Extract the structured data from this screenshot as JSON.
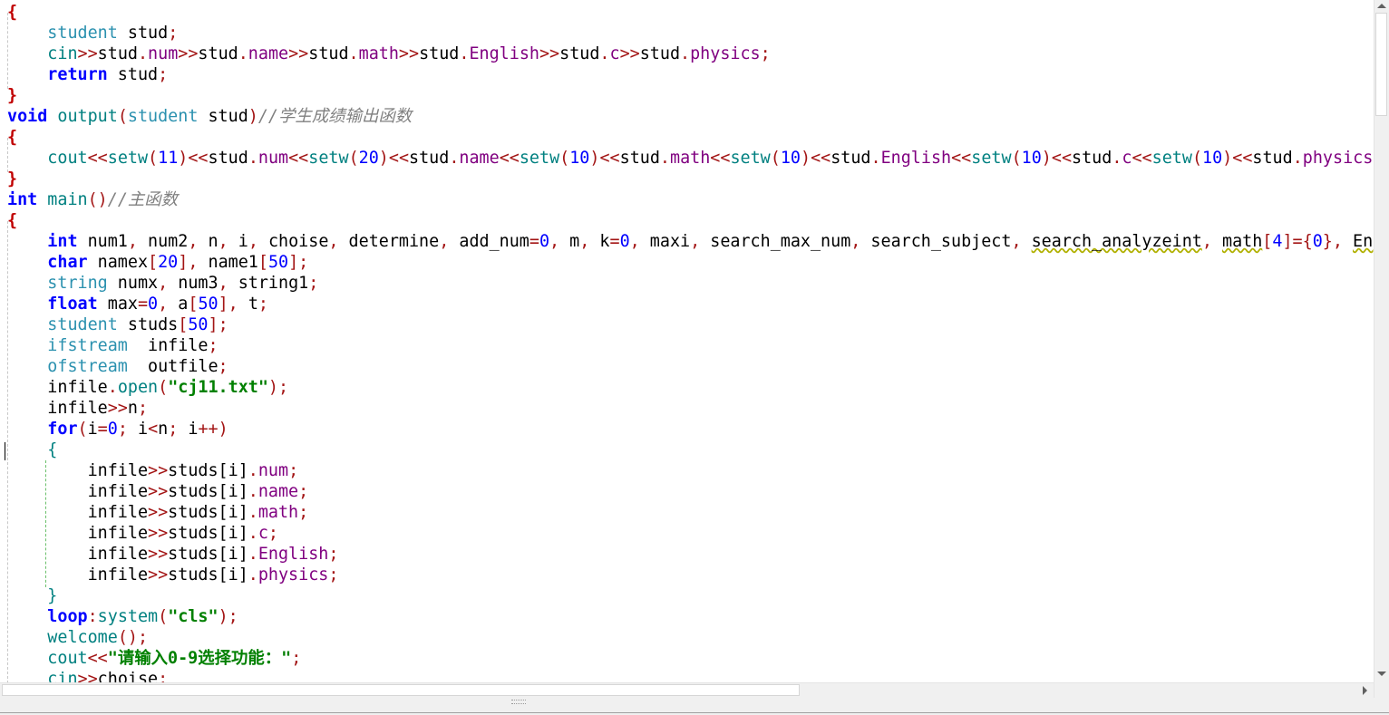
{
  "editor": {
    "lines": [
      [
        [
          "{",
          "br"
        ]
      ],
      [
        [
          "    ",
          ""
        ],
        [
          "student",
          "tp"
        ],
        [
          " stud",
          ""
        ],
        [
          ";",
          "sm"
        ]
      ],
      [
        [
          "    ",
          ""
        ],
        [
          "cin",
          "fn"
        ],
        [
          ">>",
          "op"
        ],
        [
          "stud",
          ""
        ],
        [
          ".",
          "op"
        ],
        [
          "num",
          "mb"
        ],
        [
          ">>",
          "op"
        ],
        [
          "stud",
          ""
        ],
        [
          ".",
          "op"
        ],
        [
          "name",
          "mb"
        ],
        [
          ">>",
          "op"
        ],
        [
          "stud",
          ""
        ],
        [
          ".",
          "op"
        ],
        [
          "math",
          "mb"
        ],
        [
          ">>",
          "op"
        ],
        [
          "stud",
          ""
        ],
        [
          ".",
          "op"
        ],
        [
          "English",
          "mb"
        ],
        [
          ">>",
          "op"
        ],
        [
          "stud",
          ""
        ],
        [
          ".",
          "op"
        ],
        [
          "c",
          "mb"
        ],
        [
          ">>",
          "op"
        ],
        [
          "stud",
          ""
        ],
        [
          ".",
          "op"
        ],
        [
          "physics",
          "mb"
        ],
        [
          ";",
          "sm"
        ]
      ],
      [
        [
          "    ",
          ""
        ],
        [
          "return",
          "kw"
        ],
        [
          " stud",
          ""
        ],
        [
          ";",
          "sm"
        ]
      ],
      [
        [
          "}",
          "br"
        ]
      ],
      [
        [
          "void",
          "kw"
        ],
        [
          " ",
          ""
        ],
        [
          "output",
          "fn"
        ],
        [
          "(",
          "op"
        ],
        [
          "student",
          "tp"
        ],
        [
          " stud",
          ""
        ],
        [
          ")",
          "op"
        ],
        [
          "//学生成绩输出函数",
          "cm"
        ]
      ],
      [
        [
          "{",
          "br"
        ]
      ],
      [
        [
          "    ",
          ""
        ],
        [
          "cout",
          "fn"
        ],
        [
          "<<",
          "op"
        ],
        [
          "setw",
          "fn"
        ],
        [
          "(",
          "op"
        ],
        [
          "11",
          "nm"
        ],
        [
          ")",
          "op"
        ],
        [
          "<<",
          "op"
        ],
        [
          "stud",
          ""
        ],
        [
          ".",
          "op"
        ],
        [
          "num",
          "mb"
        ],
        [
          "<<",
          "op"
        ],
        [
          "setw",
          "fn"
        ],
        [
          "(",
          "op"
        ],
        [
          "20",
          "nm"
        ],
        [
          ")",
          "op"
        ],
        [
          "<<",
          "op"
        ],
        [
          "stud",
          ""
        ],
        [
          ".",
          "op"
        ],
        [
          "name",
          "mb"
        ],
        [
          "<<",
          "op"
        ],
        [
          "setw",
          "fn"
        ],
        [
          "(",
          "op"
        ],
        [
          "10",
          "nm"
        ],
        [
          ")",
          "op"
        ],
        [
          "<<",
          "op"
        ],
        [
          "stud",
          ""
        ],
        [
          ".",
          "op"
        ],
        [
          "math",
          "mb"
        ],
        [
          "<<",
          "op"
        ],
        [
          "setw",
          "fn"
        ],
        [
          "(",
          "op"
        ],
        [
          "10",
          "nm"
        ],
        [
          ")",
          "op"
        ],
        [
          "<<",
          "op"
        ],
        [
          "stud",
          ""
        ],
        [
          ".",
          "op"
        ],
        [
          "English",
          "mb"
        ],
        [
          "<<",
          "op"
        ],
        [
          "setw",
          "fn"
        ],
        [
          "(",
          "op"
        ],
        [
          "10",
          "nm"
        ],
        [
          ")",
          "op"
        ],
        [
          "<<",
          "op"
        ],
        [
          "stud",
          ""
        ],
        [
          ".",
          "op"
        ],
        [
          "c",
          "mb"
        ],
        [
          "<<",
          "op"
        ],
        [
          "setw",
          "fn"
        ],
        [
          "(",
          "op"
        ],
        [
          "10",
          "nm"
        ],
        [
          ")",
          "op"
        ],
        [
          "<<",
          "op"
        ],
        [
          "stud",
          ""
        ],
        [
          ".",
          "op"
        ],
        [
          "physics",
          "mb"
        ],
        [
          "<",
          "op"
        ]
      ],
      [
        [
          "}",
          "br"
        ]
      ],
      [
        [
          "int",
          "kw"
        ],
        [
          " ",
          ""
        ],
        [
          "main",
          "fn"
        ],
        [
          "()",
          "op"
        ],
        [
          "//主函数",
          "cm"
        ]
      ],
      [
        [
          "{",
          "br"
        ]
      ],
      [
        [
          "    ",
          ""
        ],
        [
          "int",
          "kw"
        ],
        [
          " num1",
          ""
        ],
        [
          ",",
          "op"
        ],
        [
          " num2",
          ""
        ],
        [
          ",",
          "op"
        ],
        [
          " n",
          ""
        ],
        [
          ",",
          "op"
        ],
        [
          " i",
          ""
        ],
        [
          ",",
          "op"
        ],
        [
          " choise",
          ""
        ],
        [
          ",",
          "op"
        ],
        [
          " determine",
          ""
        ],
        [
          ",",
          "op"
        ],
        [
          " add_num",
          ""
        ],
        [
          "=",
          "op"
        ],
        [
          "0",
          "nm"
        ],
        [
          ",",
          "op"
        ],
        [
          " m",
          ""
        ],
        [
          ",",
          "op"
        ],
        [
          " k",
          ""
        ],
        [
          "=",
          "op"
        ],
        [
          "0",
          "nm"
        ],
        [
          ",",
          "op"
        ],
        [
          " maxi",
          ""
        ],
        [
          ",",
          "op"
        ],
        [
          " search_max_num",
          ""
        ],
        [
          ",",
          "op"
        ],
        [
          " search_subject",
          ""
        ],
        [
          ",",
          "op"
        ],
        [
          " ",
          ""
        ],
        [
          "search_analyzeint",
          "sq"
        ],
        [
          ",",
          "op"
        ],
        [
          " ",
          ""
        ],
        [
          "math",
          "sq"
        ],
        [
          "[",
          "op"
        ],
        [
          "4",
          "nm"
        ],
        [
          "]",
          "op"
        ],
        [
          "={",
          "op"
        ],
        [
          "0",
          "nm"
        ],
        [
          "}",
          "op"
        ],
        [
          ",",
          "op"
        ],
        [
          " ",
          ""
        ],
        [
          "Eng",
          "sq"
        ]
      ],
      [
        [
          "    ",
          ""
        ],
        [
          "char",
          "kw"
        ],
        [
          " namex",
          ""
        ],
        [
          "[",
          "op"
        ],
        [
          "20",
          "nm"
        ],
        [
          "]",
          "op"
        ],
        [
          ",",
          "op"
        ],
        [
          " name1",
          ""
        ],
        [
          "[",
          "op"
        ],
        [
          "50",
          "nm"
        ],
        [
          "]",
          "op"
        ],
        [
          ";",
          "sm"
        ]
      ],
      [
        [
          "    ",
          ""
        ],
        [
          "string",
          "tp"
        ],
        [
          " numx",
          ""
        ],
        [
          ",",
          "op"
        ],
        [
          " num3",
          ""
        ],
        [
          ",",
          "op"
        ],
        [
          " string1",
          ""
        ],
        [
          ";",
          "sm"
        ]
      ],
      [
        [
          "    ",
          ""
        ],
        [
          "float",
          "kw"
        ],
        [
          " max",
          ""
        ],
        [
          "=",
          "op"
        ],
        [
          "0",
          "nm"
        ],
        [
          ",",
          "op"
        ],
        [
          " a",
          ""
        ],
        [
          "[",
          "op"
        ],
        [
          "50",
          "nm"
        ],
        [
          "]",
          "op"
        ],
        [
          ",",
          "op"
        ],
        [
          " t",
          ""
        ],
        [
          ";",
          "sm"
        ]
      ],
      [
        [
          "    ",
          ""
        ],
        [
          "student",
          "tp"
        ],
        [
          " studs",
          ""
        ],
        [
          "[",
          "op"
        ],
        [
          "50",
          "nm"
        ],
        [
          "]",
          "op"
        ],
        [
          ";",
          "sm"
        ]
      ],
      [
        [
          "    ",
          ""
        ],
        [
          "ifstream",
          "tp"
        ],
        [
          "  infile",
          ""
        ],
        [
          ";",
          "sm"
        ]
      ],
      [
        [
          "    ",
          ""
        ],
        [
          "ofstream",
          "tp"
        ],
        [
          "  outfile",
          ""
        ],
        [
          ";",
          "sm"
        ]
      ],
      [
        [
          "    ",
          ""
        ],
        [
          "infile",
          ""
        ],
        [
          ".",
          "op"
        ],
        [
          "open",
          "fn"
        ],
        [
          "(",
          "op"
        ],
        [
          "\"cj11.txt\"",
          "st"
        ],
        [
          ")",
          "op"
        ],
        [
          ";",
          "sm"
        ]
      ],
      [
        [
          "    ",
          ""
        ],
        [
          "infile",
          ""
        ],
        [
          ">>",
          "op"
        ],
        [
          "n",
          ""
        ],
        [
          ";",
          "sm"
        ]
      ],
      [
        [
          "    ",
          ""
        ],
        [
          "for",
          "kw"
        ],
        [
          "(",
          "op"
        ],
        [
          "i",
          ""
        ],
        [
          "=",
          "op"
        ],
        [
          "0",
          "nm"
        ],
        [
          ";",
          "sm"
        ],
        [
          " i",
          ""
        ],
        [
          "<",
          "op"
        ],
        [
          "n",
          ""
        ],
        [
          ";",
          "sm"
        ],
        [
          " i",
          ""
        ],
        [
          "++",
          "op"
        ],
        [
          ")",
          "op"
        ]
      ],
      [
        [
          "    ",
          ""
        ],
        [
          "{",
          "fn"
        ]
      ],
      [
        [
          "        ",
          ""
        ],
        [
          "infile",
          ""
        ],
        [
          ">>",
          "op"
        ],
        [
          "studs",
          ""
        ],
        [
          "[i]",
          ""
        ],
        [
          ".",
          "op"
        ],
        [
          "num",
          "mb"
        ],
        [
          ";",
          "sm"
        ]
      ],
      [
        [
          "        ",
          ""
        ],
        [
          "infile",
          ""
        ],
        [
          ">>",
          "op"
        ],
        [
          "studs",
          ""
        ],
        [
          "[i]",
          ""
        ],
        [
          ".",
          "op"
        ],
        [
          "name",
          "mb"
        ],
        [
          ";",
          "sm"
        ]
      ],
      [
        [
          "        ",
          ""
        ],
        [
          "infile",
          ""
        ],
        [
          ">>",
          "op"
        ],
        [
          "studs",
          ""
        ],
        [
          "[i]",
          ""
        ],
        [
          ".",
          "op"
        ],
        [
          "math",
          "mb"
        ],
        [
          ";",
          "sm"
        ]
      ],
      [
        [
          "        ",
          ""
        ],
        [
          "infile",
          ""
        ],
        [
          ">>",
          "op"
        ],
        [
          "studs",
          ""
        ],
        [
          "[i]",
          ""
        ],
        [
          ".",
          "op"
        ],
        [
          "c",
          "mb"
        ],
        [
          ";",
          "sm"
        ]
      ],
      [
        [
          "        ",
          ""
        ],
        [
          "infile",
          ""
        ],
        [
          ">>",
          "op"
        ],
        [
          "studs",
          ""
        ],
        [
          "[i]",
          ""
        ],
        [
          ".",
          "op"
        ],
        [
          "English",
          "mb"
        ],
        [
          ";",
          "sm"
        ]
      ],
      [
        [
          "        ",
          ""
        ],
        [
          "infile",
          ""
        ],
        [
          ">>",
          "op"
        ],
        [
          "studs",
          ""
        ],
        [
          "[i]",
          ""
        ],
        [
          ".",
          "op"
        ],
        [
          "physics",
          "mb"
        ],
        [
          ";",
          "sm"
        ]
      ],
      [
        [
          "    ",
          ""
        ],
        [
          "}",
          "fn"
        ]
      ],
      [
        [
          "    ",
          ""
        ],
        [
          "loop",
          "kw"
        ],
        [
          ":",
          "op"
        ],
        [
          "system",
          "fn"
        ],
        [
          "(",
          "op"
        ],
        [
          "\"cls\"",
          "st"
        ],
        [
          ")",
          "op"
        ],
        [
          ";",
          "sm"
        ]
      ],
      [
        [
          "    ",
          ""
        ],
        [
          "welcome",
          "fn"
        ],
        [
          "()",
          "op"
        ],
        [
          ";",
          "sm"
        ]
      ],
      [
        [
          "    ",
          ""
        ],
        [
          "cout",
          "fn"
        ],
        [
          "<<",
          "op"
        ],
        [
          "\"请输入0-9选择功能：\"",
          "st"
        ],
        [
          ";",
          "sm"
        ]
      ],
      [
        [
          "    ",
          ""
        ],
        [
          "cin",
          "fn"
        ],
        [
          ">>",
          "op"
        ],
        [
          "choise",
          ""
        ],
        [
          ";",
          "sm"
        ]
      ]
    ]
  },
  "scrollbars": {
    "vertical": {
      "up_icon": "arrow-up",
      "down_icon": "arrow-down"
    },
    "horizontal": {
      "right_icon": "arrow-right"
    }
  },
  "colors": {
    "keyword": "#0000ff",
    "type": "#2b91af",
    "function": "#008080",
    "member": "#800080",
    "operator": "#a31515",
    "number": "#0000ff",
    "string": "#008000",
    "comment": "#808080",
    "brace": "#c00000"
  }
}
